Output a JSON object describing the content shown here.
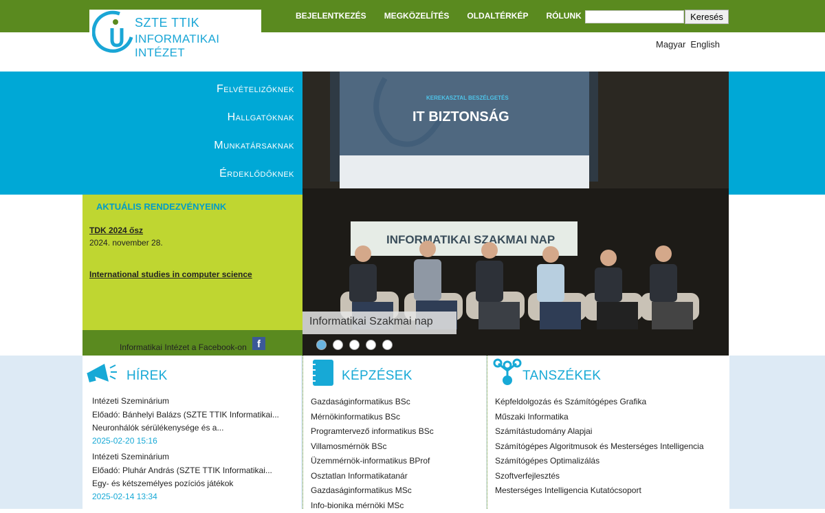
{
  "logo": {
    "line1": "SZTE TTIK",
    "line2": "INFORMATIKAI INTÉZET"
  },
  "topnav": [
    "BEJELENTKEZÉS",
    "MEGKÖZELÍTÉS",
    "OLDALTÉRKÉP",
    "RÓLUNK"
  ],
  "search": {
    "placeholder": "",
    "button": "Keresés"
  },
  "lang": [
    "Magyar",
    "English"
  ],
  "mainnav": [
    "Felvételizőknek",
    "Hallgatóknak",
    "Munkatársaknak",
    "Érdeklődőknek"
  ],
  "events": {
    "title": "AKTUÁLIS RENDEZVÉNYEINK",
    "items": [
      {
        "link": "TDK 2024 ősz",
        "date": "2024. november 28."
      },
      {
        "link": "International studies in computer science",
        "date": ""
      }
    ]
  },
  "facebook": {
    "text": "Informatikai Intézet  a Facebook-on",
    "icon": "facebook-icon"
  },
  "slider": {
    "caption": "Informatikai Szakmai nap",
    "screen_small": "KEREKASZTAL BESZÉLGETÉS",
    "screen_big": "IT BIZTONSÁG",
    "banner": "INFORMATIKAI SZAKMAI NAP",
    "active_dot": 0,
    "dots": 5
  },
  "news": {
    "title": "HÍREK",
    "items": [
      {
        "category": "Intézeti Szeminárium",
        "line1": "Előadó: Bánhelyi Balázs (SZTE TTIK Informatikai...",
        "line2": "Neuronhálók sérülékenysége és a...",
        "date": "2025-02-20 15:16"
      },
      {
        "category": "Intézeti Szeminárium",
        "line1": "Előadó: Pluhár András (SZTE TTIK Informatikai...",
        "line2": "Egy- és kétszemélyes pozíciós játékok",
        "date": "2025-02-14 13:34"
      }
    ]
  },
  "programs": {
    "title": "KÉPZÉSEK",
    "items": [
      "Gazdaságinformatikus BSc",
      "Mérnökinformatikus BSc",
      "Programtervező informatikus BSc",
      "Villamosmérnök BSc",
      "Üzemmérnök-informatikus BProf",
      "Osztatlan Informatikatanár",
      "Gazdaságinformatikus MSc",
      "Info-bionika mérnöki MSc"
    ]
  },
  "departments": {
    "title": "TANSZÉKEK",
    "items": [
      "Képfeldolgozás és Számítógépes Grafika",
      "Műszaki Informatika",
      "Számítástudomány Alapjai",
      "Számítógépes Algoritmusok és Mesterséges Intelligencia",
      "Számítógépes Optimalizálás",
      "Szoftverfejlesztés",
      "Mesterséges Intelligencia Kutatócsoport"
    ]
  },
  "colors": {
    "green": "#5a8a1f",
    "blue": "#00a8d6",
    "lime": "#bfd631"
  }
}
